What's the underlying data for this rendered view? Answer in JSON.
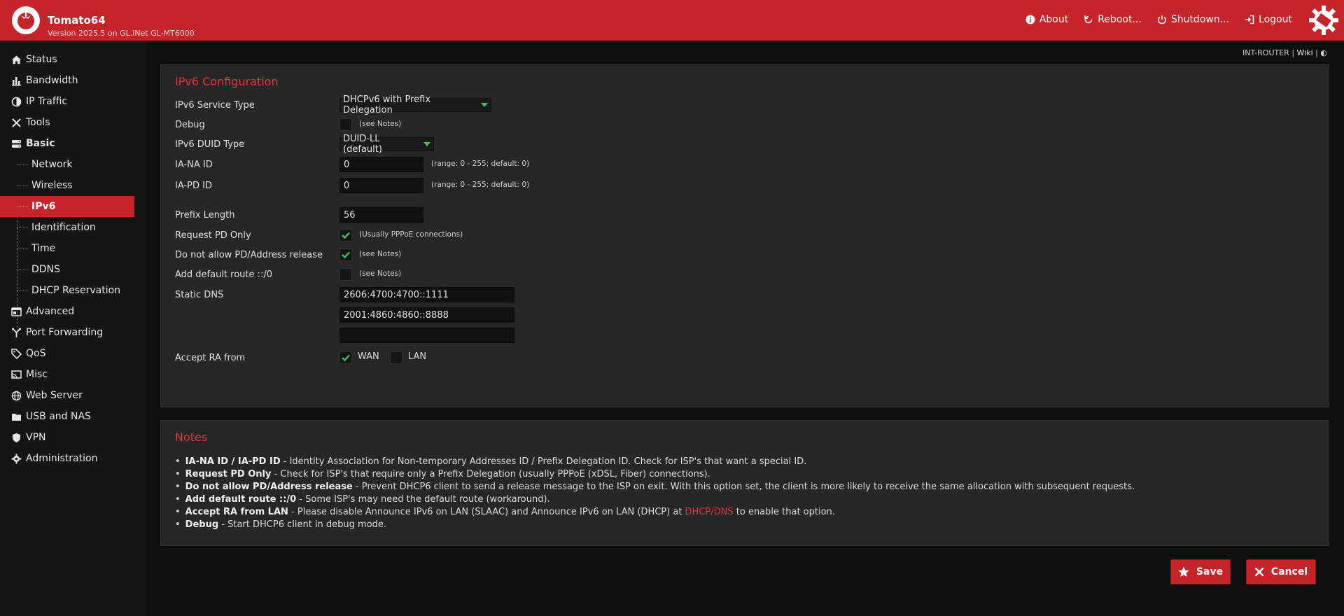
{
  "app": {
    "name": "Tomato64",
    "version": "Version 2025.5 on GL.iNet GL-MT6000"
  },
  "topnav": [
    {
      "label": "About",
      "icon": "info-icon"
    },
    {
      "label": "Reboot...",
      "icon": "reboot-icon"
    },
    {
      "label": "Shutdown...",
      "icon": "power-icon"
    },
    {
      "label": "Logout",
      "icon": "logout-icon"
    }
  ],
  "sidebar": {
    "items": [
      {
        "label": "Status",
        "icon": "home-icon"
      },
      {
        "label": "Bandwidth",
        "icon": "bar-chart-icon"
      },
      {
        "label": "IP Traffic",
        "icon": "pie-icon"
      },
      {
        "label": "Tools",
        "icon": "tools-icon"
      },
      {
        "label": "Basic",
        "icon": "server-icon"
      },
      {
        "label": "Advanced",
        "icon": "window-icon"
      },
      {
        "label": "Port Forwarding",
        "icon": "fork-icon"
      },
      {
        "label": "QoS",
        "icon": "tag-icon"
      },
      {
        "label": "Misc",
        "icon": "cast-icon"
      },
      {
        "label": "Web Server",
        "icon": "globe-icon"
      },
      {
        "label": "USB and NAS",
        "icon": "folder-icon"
      },
      {
        "label": "VPN",
        "icon": "shield-icon"
      },
      {
        "label": "Administration",
        "icon": "gear-icon"
      }
    ],
    "basic_sub": [
      "Network",
      "Wireless",
      "IPv6",
      "Identification",
      "Time",
      "DDNS",
      "DHCP Reservation"
    ],
    "active_sub": "IPv6"
  },
  "crumb": {
    "host": "INT-ROUTER",
    "sep1": "|",
    "wiki": "Wiki",
    "sep2": "|",
    "theme": "◐"
  },
  "ipv6": {
    "title": "IPv6 Configuration",
    "service_type_label": "IPv6 Service Type",
    "service_type_value": "DHCPv6 with Prefix Delegation",
    "debug_label": "Debug",
    "debug_checked": false,
    "debug_hint": "(see Notes)",
    "duid_label": "IPv6 DUID Type",
    "duid_value": "DUID-LL (default)",
    "iana_label": "IA-NA ID",
    "iana_value": "0",
    "iana_hint": "(range: 0 - 255; default: 0)",
    "iapd_label": "IA-PD ID",
    "iapd_value": "0",
    "iapd_hint": "(range: 0 - 255; default: 0)",
    "prefix_label": "Prefix Length",
    "prefix_value": "56",
    "reqpd_label": "Request PD Only",
    "reqpd_checked": true,
    "reqpd_hint": "(Usually PPPoE connections)",
    "norel_label": "Do not allow PD/Address release",
    "norel_checked": true,
    "norel_hint": "(see Notes)",
    "defroute_label": "Add default route ::/0",
    "defroute_checked": false,
    "defroute_hint": "(see Notes)",
    "dns_label": "Static DNS",
    "dns1": "2606:4700:4700::1111",
    "dns2": "2001:4860:4860::8888",
    "dns3": "",
    "ra_label": "Accept RA from",
    "ra_wan_label": "WAN",
    "ra_wan_checked": true,
    "ra_lan_label": "LAN",
    "ra_lan_checked": false
  },
  "notes": {
    "title": "Notes",
    "items": [
      {
        "term": "IA-NA ID / IA-PD ID",
        "text": " - Identity Association for Non-temporary Addresses ID / Prefix Delegation ID. Check for ISP's that want a special ID."
      },
      {
        "term": "Request PD Only",
        "text": " - Check for ISP's that require only a Prefix Delegation (usually PPPoE (xDSL, Fiber) connections)."
      },
      {
        "term": "Do not allow PD/Address release",
        "text": " - Prevent DHCP6 client to send a release message to the ISP on exit. With this option set, the client is more likely to receive the same allocation with subsequent requests."
      },
      {
        "term": "Add default route ::/0",
        "text": " - Some ISP's may need the default route (workaround)."
      },
      {
        "term": "Accept RA from LAN",
        "text": " - Please disable Announce IPv6 on LAN (SLAAC) and Announce IPv6 on LAN (DHCP) at ",
        "link": "DHCP/DNS",
        "after": " to enable that option."
      },
      {
        "term": "Debug",
        "text": " - Start DHCP6 client in debug mode."
      }
    ]
  },
  "buttons": {
    "save": "Save",
    "cancel": "Cancel"
  },
  "colors": {
    "accent": "#c4242a",
    "check": "#3ac15a"
  }
}
